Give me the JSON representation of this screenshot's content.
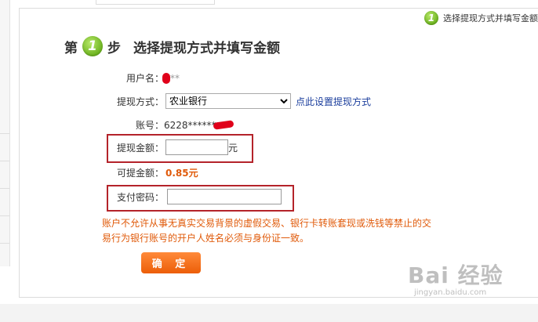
{
  "step_indicator": {
    "number": "1",
    "text": "选择提现方式并填写金额"
  },
  "heading": {
    "prefix": "第",
    "number": "1",
    "suffix": "步",
    "title": "选择提现方式并填写金额"
  },
  "form": {
    "username": {
      "label": "用户名：",
      "value": "**"
    },
    "method": {
      "label": "提现方式：",
      "selected": "农业银行",
      "link": "点此设置提现方式"
    },
    "account": {
      "label": "账号：",
      "value": "6228******"
    },
    "withdraw_amount": {
      "label": "提现金额：",
      "value": "",
      "unit": "元"
    },
    "available": {
      "label": "可提金额：",
      "value": "0.85元"
    },
    "password": {
      "label": "支付密码：",
      "value": ""
    }
  },
  "notice": "账户不允许从事无真实交易背景的虚假交易、银行卡转账套现或洗钱等禁止的交易行为银行账号的开户人姓名必须与身份证一致。",
  "confirm_label": "确 定",
  "colors": {
    "accent_green": "#6bb21e",
    "warning_orange": "#e05a0a",
    "frame_red": "#b4232a",
    "link_blue": "#1a3d9c"
  },
  "watermark": {
    "main": "Bai 经验",
    "sub": "jingyan.baidu.com"
  }
}
